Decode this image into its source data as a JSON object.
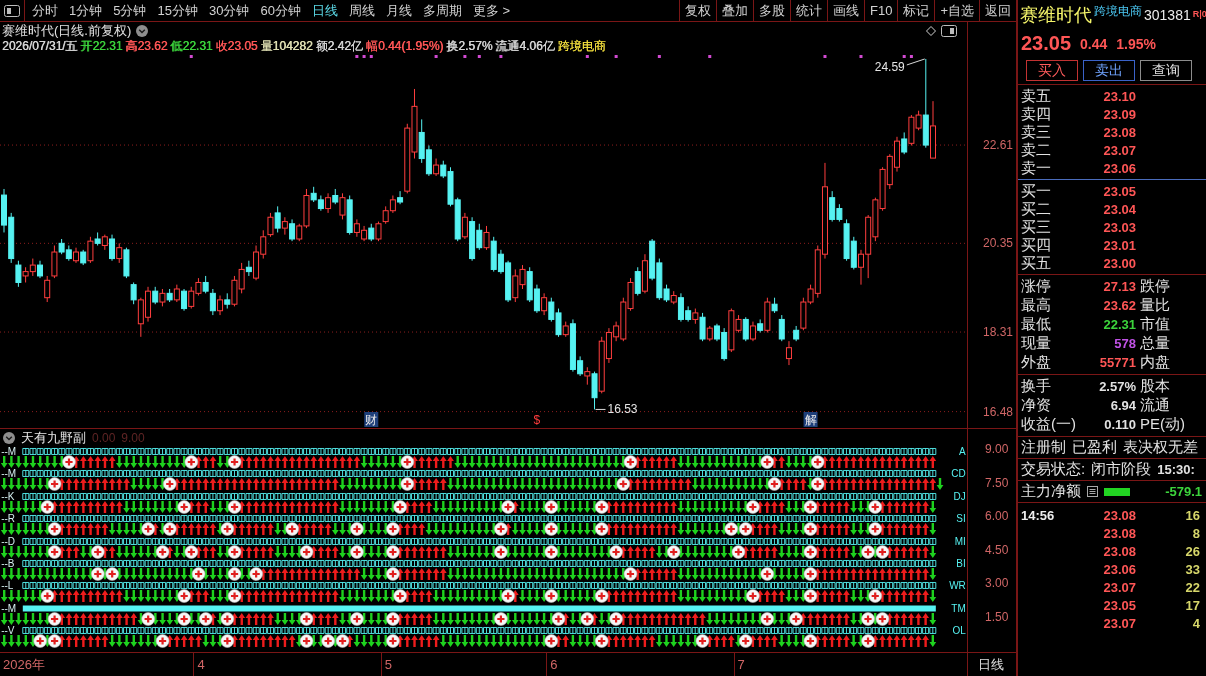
{
  "toolbar": {
    "periods": [
      {
        "label": "分时",
        "selected": false
      },
      {
        "label": "1分钟",
        "selected": false
      },
      {
        "label": "5分钟",
        "selected": false
      },
      {
        "label": "15分钟",
        "selected": false
      },
      {
        "label": "30分钟",
        "selected": false
      },
      {
        "label": "60分钟",
        "selected": false
      },
      {
        "label": "日线",
        "selected": true
      },
      {
        "label": "周线",
        "selected": false
      },
      {
        "label": "月线",
        "selected": false
      },
      {
        "label": "多周期",
        "selected": false
      },
      {
        "label": "更多 >",
        "selected": false
      }
    ],
    "tools": [
      "复权",
      "叠加",
      "多股",
      "统计",
      "画线",
      "F10",
      "标记",
      "+自选",
      "返回"
    ]
  },
  "price_chart": {
    "title": "赛维时代(日线.前复权)",
    "quote": [
      {
        "text": "2026/07/31/五",
        "color": "#d6d6d6"
      },
      {
        "text": "开22.31",
        "color": "#3cd43c"
      },
      {
        "text": "高23.62",
        "color": "#ff5656"
      },
      {
        "text": "低22.31",
        "color": "#3cd43c"
      },
      {
        "text": "收23.05",
        "color": "#ff5656"
      },
      {
        "text": "量104282",
        "color": "#e0e0b4"
      },
      {
        "text": "额2.42亿",
        "color": "#d6d6d6"
      },
      {
        "text": "幅0.44(1.95%)",
        "color": "#ff5656"
      },
      {
        "text": "换2.57%",
        "color": "#d6d6d6"
      },
      {
        "text": "流通4.06亿",
        "color": "#d6d6d6"
      },
      {
        "text": "跨境电商",
        "color": "#f0dc3c"
      }
    ],
    "events": [
      {
        "label": "财",
        "kind": "notice"
      },
      {
        "label": "$",
        "kind": "dividend"
      },
      {
        "label": "解",
        "kind": "notice"
      }
    ],
    "chart_data": [
      {
        "type": "candlestick",
        "ylim": [
          10.4,
          25.44
        ],
        "yticks": [
          16.48,
          18.31,
          20.35,
          22.61
        ],
        "grid": true,
        "annotations": [
          "24.59",
          "16.53"
        ],
        "ohlc": [
          [
            21.46,
            21.6,
            20.6,
            20.77
          ],
          [
            20.95,
            21.05,
            19.9,
            20.0
          ],
          [
            19.85,
            19.95,
            19.35,
            19.45
          ],
          [
            19.6,
            19.8,
            19.45,
            19.7
          ],
          [
            19.7,
            20.0,
            19.6,
            19.85
          ],
          [
            19.85,
            19.95,
            19.55,
            19.6
          ],
          [
            19.1,
            19.6,
            19.0,
            19.5
          ],
          [
            19.6,
            20.3,
            19.55,
            20.15
          ],
          [
            20.35,
            20.45,
            20.1,
            20.15
          ],
          [
            20.2,
            20.3,
            19.95,
            20.0
          ],
          [
            19.95,
            20.25,
            19.9,
            20.15
          ],
          [
            20.15,
            20.2,
            19.85,
            19.9
          ],
          [
            19.95,
            20.5,
            19.9,
            20.4
          ],
          [
            20.45,
            20.6,
            20.3,
            20.35
          ],
          [
            20.3,
            20.55,
            20.2,
            20.5
          ],
          [
            20.45,
            20.55,
            19.95,
            20.0
          ],
          [
            20.0,
            20.35,
            19.9,
            20.25
          ],
          [
            20.2,
            20.25,
            19.55,
            19.6
          ],
          [
            19.4,
            19.45,
            18.95,
            19.05
          ],
          [
            18.5,
            19.1,
            18.2,
            19.05
          ],
          [
            18.65,
            19.35,
            18.55,
            19.25
          ],
          [
            19.25,
            19.35,
            18.95,
            19.0
          ],
          [
            19.0,
            19.3,
            18.9,
            19.2
          ],
          [
            19.2,
            19.3,
            19.0,
            19.05
          ],
          [
            19.05,
            19.4,
            19.0,
            19.3
          ],
          [
            19.25,
            19.3,
            18.8,
            18.85
          ],
          [
            18.9,
            19.35,
            18.85,
            19.25
          ],
          [
            19.2,
            19.55,
            19.15,
            19.45
          ],
          [
            19.45,
            19.6,
            19.2,
            19.25
          ],
          [
            19.2,
            19.3,
            18.7,
            18.8
          ],
          [
            18.8,
            19.15,
            18.7,
            19.05
          ],
          [
            19.05,
            19.2,
            18.85,
            18.95
          ],
          [
            18.95,
            19.6,
            18.9,
            19.5
          ],
          [
            19.3,
            19.9,
            19.2,
            19.75
          ],
          [
            19.8,
            19.95,
            19.6,
            19.7
          ],
          [
            19.55,
            20.3,
            19.5,
            20.15
          ],
          [
            20.1,
            20.65,
            20.0,
            20.5
          ],
          [
            20.55,
            21.05,
            20.5,
            20.95
          ],
          [
            21.05,
            21.2,
            20.6,
            20.7
          ],
          [
            20.7,
            20.95,
            20.55,
            20.85
          ],
          [
            20.8,
            20.9,
            20.4,
            20.45
          ],
          [
            20.45,
            20.8,
            20.4,
            20.75
          ],
          [
            20.75,
            21.6,
            20.7,
            21.45
          ],
          [
            21.5,
            21.65,
            21.3,
            21.35
          ],
          [
            21.35,
            21.45,
            21.1,
            21.15
          ],
          [
            21.15,
            21.5,
            21.05,
            21.4
          ],
          [
            21.45,
            21.6,
            21.25,
            21.3
          ],
          [
            21.0,
            21.5,
            20.9,
            21.4
          ],
          [
            21.35,
            21.45,
            20.55,
            20.6
          ],
          [
            20.6,
            20.9,
            20.5,
            20.8
          ],
          [
            20.45,
            20.75,
            20.4,
            20.65
          ],
          [
            20.7,
            20.8,
            20.4,
            20.45
          ],
          [
            20.45,
            20.85,
            20.4,
            20.8
          ],
          [
            20.85,
            21.2,
            20.8,
            21.1
          ],
          [
            21.1,
            21.45,
            21.05,
            21.35
          ],
          [
            21.4,
            21.55,
            21.25,
            21.3
          ],
          [
            21.55,
            23.1,
            21.5,
            23.0
          ],
          [
            22.45,
            23.9,
            22.3,
            23.5
          ],
          [
            22.9,
            23.2,
            22.2,
            22.3
          ],
          [
            22.5,
            22.6,
            21.9,
            21.95
          ],
          [
            21.95,
            22.3,
            21.9,
            22.15
          ],
          [
            22.15,
            22.25,
            21.85,
            21.9
          ],
          [
            22.0,
            22.1,
            21.2,
            21.25
          ],
          [
            21.35,
            21.4,
            20.4,
            20.45
          ],
          [
            20.5,
            21.05,
            20.45,
            20.95
          ],
          [
            20.85,
            20.95,
            19.95,
            20.0
          ],
          [
            20.65,
            20.8,
            20.2,
            20.25
          ],
          [
            20.25,
            20.75,
            20.2,
            20.6
          ],
          [
            20.4,
            20.5,
            19.7,
            19.75
          ],
          [
            20.1,
            20.2,
            19.65,
            19.7
          ],
          [
            19.9,
            19.95,
            19.0,
            19.05
          ],
          [
            19.1,
            19.75,
            19.0,
            19.6
          ],
          [
            19.4,
            19.85,
            19.3,
            19.75
          ],
          [
            19.7,
            19.8,
            19.0,
            19.05
          ],
          [
            19.3,
            19.4,
            18.75,
            18.8
          ],
          [
            18.8,
            19.2,
            18.7,
            19.1
          ],
          [
            19.0,
            19.1,
            18.55,
            18.6
          ],
          [
            18.75,
            18.85,
            18.2,
            18.25
          ],
          [
            18.25,
            18.55,
            18.2,
            18.45
          ],
          [
            18.5,
            18.6,
            17.4,
            17.45
          ],
          [
            17.65,
            17.75,
            17.3,
            17.35
          ],
          [
            17.3,
            17.5,
            17.1,
            17.4
          ],
          [
            17.35,
            17.4,
            16.53,
            16.8
          ],
          [
            16.95,
            18.2,
            16.9,
            18.1
          ],
          [
            17.7,
            18.4,
            17.6,
            18.3
          ],
          [
            18.2,
            18.55,
            18.1,
            18.45
          ],
          [
            18.15,
            19.1,
            18.1,
            19.0
          ],
          [
            18.85,
            19.55,
            18.8,
            19.45
          ],
          [
            19.7,
            19.8,
            19.15,
            19.2
          ],
          [
            19.25,
            20.1,
            19.2,
            19.95
          ],
          [
            20.4,
            20.45,
            19.5,
            19.55
          ],
          [
            19.9,
            20.0,
            19.05,
            19.1
          ],
          [
            19.3,
            19.4,
            19.0,
            19.05
          ],
          [
            19.0,
            19.25,
            18.95,
            19.15
          ],
          [
            19.1,
            19.2,
            18.55,
            18.6
          ],
          [
            18.8,
            18.9,
            18.55,
            18.6
          ],
          [
            18.6,
            18.85,
            18.5,
            18.75
          ],
          [
            18.65,
            18.75,
            18.1,
            18.15
          ],
          [
            18.15,
            18.45,
            18.1,
            18.4
          ],
          [
            18.45,
            18.5,
            18.1,
            18.15
          ],
          [
            18.3,
            18.4,
            17.65,
            17.7
          ],
          [
            17.9,
            18.85,
            17.85,
            18.8
          ],
          [
            18.35,
            18.7,
            18.3,
            18.6
          ],
          [
            18.6,
            18.65,
            18.1,
            18.15
          ],
          [
            18.15,
            18.55,
            18.1,
            18.45
          ],
          [
            18.5,
            18.6,
            18.3,
            18.35
          ],
          [
            18.35,
            19.1,
            18.3,
            19.0
          ],
          [
            18.95,
            19.1,
            18.75,
            18.8
          ],
          [
            18.6,
            18.7,
            18.1,
            18.15
          ],
          [
            17.7,
            18.1,
            17.55,
            17.95
          ],
          [
            18.35,
            18.45,
            18.1,
            18.15
          ],
          [
            18.4,
            19.1,
            18.35,
            19.0
          ],
          [
            19.0,
            19.4,
            18.95,
            19.3
          ],
          [
            19.2,
            20.3,
            19.1,
            20.2
          ],
          [
            20.1,
            22.2,
            20.0,
            21.65
          ],
          [
            21.4,
            21.55,
            20.85,
            20.9
          ],
          [
            21.15,
            21.25,
            20.85,
            20.9
          ],
          [
            20.8,
            20.9,
            19.95,
            20.0
          ],
          [
            20.4,
            20.5,
            19.75,
            19.8
          ],
          [
            19.8,
            20.2,
            19.4,
            20.1
          ],
          [
            20.1,
            21.0,
            19.55,
            20.95
          ],
          [
            20.5,
            21.4,
            20.4,
            21.35
          ],
          [
            21.15,
            22.1,
            21.1,
            22.05
          ],
          [
            21.7,
            22.4,
            21.6,
            22.35
          ],
          [
            22.1,
            22.8,
            22.0,
            22.7
          ],
          [
            22.75,
            22.9,
            22.4,
            22.45
          ],
          [
            22.65,
            23.3,
            22.6,
            23.25
          ],
          [
            23.0,
            23.4,
            22.95,
            23.3
          ],
          [
            23.3,
            24.59,
            22.55,
            22.61
          ],
          [
            22.31,
            23.62,
            22.31,
            23.05
          ]
        ]
      }
    ]
  },
  "indicator": {
    "title": "天有九野副",
    "params": [
      "0.00",
      "9.00"
    ],
    "axis_labels": [
      "9.00",
      "7.50",
      "6.00",
      "4.50",
      "3.00",
      "1.50"
    ],
    "rows": [
      {
        "lead": "--M",
        "tail": "A",
        "filled": false
      },
      {
        "lead": "--M",
        "tail": "CD",
        "filled": false
      },
      {
        "lead": "--K",
        "tail": "DJ",
        "filled": false
      },
      {
        "lead": "--R",
        "tail": "SI",
        "filled": false
      },
      {
        "lead": "--D",
        "tail": "MI",
        "filled": false
      },
      {
        "lead": "--B",
        "tail": "BI",
        "filled": false
      },
      {
        "lead": "--L",
        "tail": "WR",
        "filled": false
      },
      {
        "lead": "--M",
        "tail": "TM",
        "filled": true
      },
      {
        "lead": "--V",
        "tail": "OL",
        "filled": false
      }
    ]
  },
  "date_axis": {
    "labels": [
      "2026年",
      "4",
      "5",
      "6",
      "7"
    ],
    "period": "日线"
  },
  "quote_panel": {
    "name": "赛维时代",
    "sector": "跨境电商",
    "code": "301381",
    "flag": "R|0",
    "price": "23.05",
    "change": "0.44",
    "change_pct": "1.95%",
    "actions": [
      {
        "label": "买入",
        "kind": "buy"
      },
      {
        "label": "卖出",
        "kind": "sell"
      },
      {
        "label": "查询",
        "kind": "query"
      }
    ],
    "asks": [
      {
        "label": "卖五",
        "price": "23.10"
      },
      {
        "label": "卖四",
        "price": "23.09"
      },
      {
        "label": "卖三",
        "price": "23.08"
      },
      {
        "label": "卖二",
        "price": "23.07"
      },
      {
        "label": "卖一",
        "price": "23.06"
      }
    ],
    "bids": [
      {
        "label": "买一",
        "price": "23.05"
      },
      {
        "label": "买二",
        "price": "23.04"
      },
      {
        "label": "买三",
        "price": "23.03"
      },
      {
        "label": "买四",
        "price": "23.01"
      },
      {
        "label": "买五",
        "price": "23.00"
      }
    ],
    "stats": [
      {
        "label": "涨停",
        "value": "27.13",
        "color": "#ff5656",
        "right_label": "跌停"
      },
      {
        "label": "最高",
        "value": "23.62",
        "color": "#ff5656",
        "right_label": "量比"
      },
      {
        "label": "最低",
        "value": "22.31",
        "color": "#3cd43c",
        "right_label": "市值"
      },
      {
        "label": "现量",
        "value": "578",
        "color": "#c052e6",
        "right_label": "总量"
      },
      {
        "label": "外盘",
        "value": "55771",
        "color": "#ff5656",
        "right_label": "内盘"
      }
    ],
    "fundamentals": [
      {
        "label": "换手",
        "value": "2.57%",
        "right_label": "股本"
      },
      {
        "label": "净资",
        "value": "6.94",
        "right_label": "流通"
      },
      {
        "label": "收益(一)",
        "value": "0.110",
        "right_label": "PE(动)"
      }
    ],
    "tags": [
      "注册制",
      "已盈利",
      "表决权无差"
    ],
    "trade_status": {
      "label": "交易状态:",
      "value": "闭市阶段",
      "time": "15:30:"
    },
    "main_force": {
      "label": "主力净额",
      "value": "-579.1"
    },
    "ticks": [
      {
        "time": "14:56",
        "price": "23.08",
        "volume": "16"
      },
      {
        "price": "23.08",
        "volume": "8"
      },
      {
        "price": "23.08",
        "volume": "26"
      },
      {
        "price": "23.06",
        "volume": "33"
      },
      {
        "price": "23.07",
        "volume": "22"
      },
      {
        "price": "23.05",
        "volume": "17"
      },
      {
        "price": "23.07",
        "volume": "4"
      }
    ]
  }
}
